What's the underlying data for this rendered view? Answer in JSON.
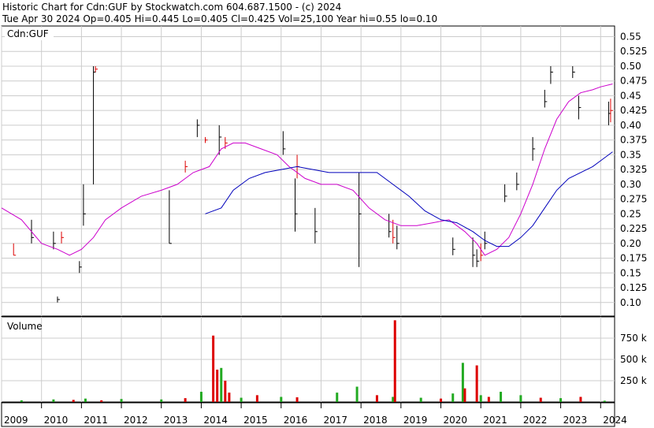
{
  "header": {
    "line1": "Historic Chart for Cdn:GUF by Stockwatch.com 604.687.1500 - (c) 2024",
    "line2": "Tue Apr 30 2024   Op=0.405   Hi=0.445   Lo=0.405   Cl=0.425   Vol=25,100   Year hi=0.55   lo=0.10"
  },
  "price_panel": {
    "label": "Cdn:GUF"
  },
  "volume_panel": {
    "label": "Volume"
  },
  "colors": {
    "price_up": "#000000",
    "price_down": "#dd0000",
    "ma_short": "#cc00cc",
    "ma_long": "#0000bb",
    "vol_up": "#22aa22",
    "vol_down": "#dd0000",
    "vol_flat": "#888888",
    "grid": "#cccccc"
  },
  "chart_data": [
    {
      "type": "line",
      "name": "price",
      "y_ticks": [
        "0.55",
        "0.525",
        "0.50",
        "0.475",
        "0.45",
        "0.425",
        "0.40",
        "0.375",
        "0.35",
        "0.325",
        "0.30",
        "0.275",
        "0.25",
        "0.225",
        "0.20",
        "0.175",
        "0.15",
        "0.125",
        "0.10"
      ],
      "y_tick_values": [
        0.55,
        0.525,
        0.5,
        0.475,
        0.45,
        0.425,
        0.4,
        0.375,
        0.35,
        0.325,
        0.3,
        0.275,
        0.25,
        0.225,
        0.2,
        0.175,
        0.15,
        0.125,
        0.1
      ],
      "ylim": [
        0.077,
        0.568
      ],
      "xlim": [
        2009.0,
        2024.35
      ],
      "x_ticks": [
        "2009",
        "2010",
        "2011",
        "2012",
        "2013",
        "2014",
        "2015",
        "2016",
        "2017",
        "2018",
        "2019",
        "2020",
        "2021",
        "2022",
        "2023",
        "2024"
      ],
      "x_tick_values": [
        2009,
        2010,
        2011,
        2012,
        2013,
        2014,
        2015,
        2016,
        2017,
        2018,
        2019,
        2020,
        2021,
        2022,
        2023,
        2024
      ],
      "bars": [
        {
          "x": 2009.3,
          "hi": 0.2,
          "lo": 0.18,
          "c": 0.18,
          "up": false
        },
        {
          "x": 2009.75,
          "hi": 0.24,
          "lo": 0.2,
          "c": 0.21,
          "up": true
        },
        {
          "x": 2010.3,
          "hi": 0.22,
          "lo": 0.19,
          "c": 0.2,
          "up": true
        },
        {
          "x": 2010.4,
          "hi": 0.11,
          "lo": 0.1,
          "c": 0.105,
          "up": true
        },
        {
          "x": 2010.5,
          "hi": 0.22,
          "lo": 0.2,
          "c": 0.21,
          "up": false
        },
        {
          "x": 2010.95,
          "hi": 0.17,
          "lo": 0.15,
          "c": 0.16,
          "up": true
        },
        {
          "x": 2011.05,
          "hi": 0.3,
          "lo": 0.23,
          "c": 0.25,
          "up": true
        },
        {
          "x": 2011.3,
          "hi": 0.5,
          "lo": 0.3,
          "c": 0.49,
          "up": true
        },
        {
          "x": 2011.35,
          "hi": 0.5,
          "lo": 0.49,
          "c": 0.495,
          "up": false
        },
        {
          "x": 2013.2,
          "hi": 0.29,
          "lo": 0.2,
          "c": 0.2,
          "up": true
        },
        {
          "x": 2013.6,
          "hi": 0.34,
          "lo": 0.32,
          "c": 0.33,
          "up": false
        },
        {
          "x": 2013.9,
          "hi": 0.41,
          "lo": 0.38,
          "c": 0.4,
          "up": true
        },
        {
          "x": 2014.1,
          "hi": 0.38,
          "lo": 0.37,
          "c": 0.375,
          "up": false
        },
        {
          "x": 2014.45,
          "hi": 0.4,
          "lo": 0.35,
          "c": 0.38,
          "up": true
        },
        {
          "x": 2014.6,
          "hi": 0.38,
          "lo": 0.36,
          "c": 0.37,
          "up": false
        },
        {
          "x": 2016.05,
          "hi": 0.39,
          "lo": 0.35,
          "c": 0.36,
          "up": true
        },
        {
          "x": 2016.35,
          "hi": 0.31,
          "lo": 0.22,
          "c": 0.25,
          "up": true
        },
        {
          "x": 2016.4,
          "hi": 0.35,
          "lo": 0.31,
          "c": 0.33,
          "up": false
        },
        {
          "x": 2016.85,
          "hi": 0.26,
          "lo": 0.2,
          "c": 0.22,
          "up": true
        },
        {
          "x": 2017.95,
          "hi": 0.32,
          "lo": 0.16,
          "c": 0.25,
          "up": true
        },
        {
          "x": 2018.7,
          "hi": 0.25,
          "lo": 0.21,
          "c": 0.22,
          "up": true
        },
        {
          "x": 2018.8,
          "hi": 0.24,
          "lo": 0.2,
          "c": 0.21,
          "up": false
        },
        {
          "x": 2018.9,
          "hi": 0.23,
          "lo": 0.19,
          "c": 0.2,
          "up": true
        },
        {
          "x": 2020.3,
          "hi": 0.21,
          "lo": 0.18,
          "c": 0.19,
          "up": true
        },
        {
          "x": 2020.8,
          "hi": 0.21,
          "lo": 0.16,
          "c": 0.18,
          "up": true
        },
        {
          "x": 2020.9,
          "hi": 0.19,
          "lo": 0.16,
          "c": 0.17,
          "up": true
        },
        {
          "x": 2021.0,
          "hi": 0.2,
          "lo": 0.17,
          "c": 0.18,
          "up": false
        },
        {
          "x": 2021.1,
          "hi": 0.22,
          "lo": 0.19,
          "c": 0.2,
          "up": true
        },
        {
          "x": 2021.6,
          "hi": 0.3,
          "lo": 0.27,
          "c": 0.28,
          "up": true
        },
        {
          "x": 2021.9,
          "hi": 0.32,
          "lo": 0.29,
          "c": 0.3,
          "up": true
        },
        {
          "x": 2022.3,
          "hi": 0.38,
          "lo": 0.34,
          "c": 0.36,
          "up": true
        },
        {
          "x": 2022.6,
          "hi": 0.46,
          "lo": 0.43,
          "c": 0.44,
          "up": true
        },
        {
          "x": 2022.75,
          "hi": 0.5,
          "lo": 0.47,
          "c": 0.49,
          "up": true
        },
        {
          "x": 2023.3,
          "hi": 0.5,
          "lo": 0.48,
          "c": 0.49,
          "up": true
        },
        {
          "x": 2023.45,
          "hi": 0.45,
          "lo": 0.41,
          "c": 0.43,
          "up": true
        },
        {
          "x": 2024.2,
          "hi": 0.44,
          "lo": 0.4,
          "c": 0.42,
          "up": true
        },
        {
          "x": 2024.25,
          "hi": 0.445,
          "lo": 0.405,
          "c": 0.425,
          "up": false
        }
      ],
      "ma_short": {
        "x": [
          2009.0,
          2009.5,
          2010.0,
          2010.4,
          2010.7,
          2011.0,
          2011.3,
          2011.6,
          2012.0,
          2012.5,
          2013.0,
          2013.4,
          2013.8,
          2014.2,
          2014.5,
          2014.8,
          2015.1,
          2015.5,
          2015.9,
          2016.2,
          2016.6,
          2017.0,
          2017.4,
          2017.8,
          2018.2,
          2018.6,
          2019.0,
          2019.4,
          2019.8,
          2020.2,
          2020.6,
          2020.9,
          2021.1,
          2021.4,
          2021.7,
          2022.0,
          2022.3,
          2022.6,
          2022.9,
          2023.2,
          2023.5,
          2023.8,
          2024.0,
          2024.3
        ],
        "y": [
          0.26,
          0.24,
          0.2,
          0.19,
          0.18,
          0.19,
          0.21,
          0.24,
          0.26,
          0.28,
          0.29,
          0.3,
          0.32,
          0.33,
          0.36,
          0.37,
          0.37,
          0.36,
          0.35,
          0.33,
          0.31,
          0.3,
          0.3,
          0.29,
          0.26,
          0.24,
          0.23,
          0.23,
          0.235,
          0.24,
          0.22,
          0.2,
          0.18,
          0.19,
          0.21,
          0.25,
          0.3,
          0.36,
          0.41,
          0.44,
          0.455,
          0.46,
          0.465,
          0.47
        ]
      },
      "ma_long": {
        "x": [
          2014.1,
          2014.5,
          2014.8,
          2015.2,
          2015.6,
          2016.0,
          2016.4,
          2016.8,
          2017.2,
          2017.6,
          2018.0,
          2018.4,
          2018.8,
          2019.2,
          2019.6,
          2020.0,
          2020.4,
          2020.8,
          2021.1,
          2021.4,
          2021.7,
          2022.0,
          2022.3,
          2022.6,
          2022.9,
          2023.2,
          2023.5,
          2023.8,
          2024.0,
          2024.3
        ],
        "y": [
          0.25,
          0.26,
          0.29,
          0.31,
          0.32,
          0.325,
          0.33,
          0.325,
          0.32,
          0.32,
          0.32,
          0.32,
          0.3,
          0.28,
          0.255,
          0.24,
          0.235,
          0.22,
          0.205,
          0.195,
          0.195,
          0.21,
          0.23,
          0.26,
          0.29,
          0.31,
          0.32,
          0.33,
          0.34,
          0.355
        ]
      }
    },
    {
      "type": "bar",
      "name": "Volume",
      "y_ticks": [
        "750 k",
        "500 k",
        "250 k"
      ],
      "y_tick_values": [
        750,
        500,
        250
      ],
      "ylim": [
        0,
        1000
      ],
      "x": [
        2009.5,
        2010.3,
        2010.8,
        2011.1,
        2011.5,
        2012.0,
        2013.0,
        2013.6,
        2014.0,
        2014.3,
        2014.4,
        2014.5,
        2014.6,
        2014.7,
        2015.0,
        2015.4,
        2016.0,
        2016.4,
        2017.4,
        2017.9,
        2018.4,
        2018.8,
        2018.85,
        2019.5,
        2020.0,
        2020.3,
        2020.55,
        2020.6,
        2020.9,
        2021.0,
        2021.2,
        2021.5,
        2022.0,
        2022.5,
        2023.0,
        2023.5,
        2024.1
      ],
      "values": [
        20,
        30,
        25,
        40,
        20,
        35,
        30,
        45,
        120,
        780,
        380,
        400,
        250,
        110,
        50,
        80,
        60,
        55,
        110,
        180,
        80,
        60,
        960,
        50,
        40,
        100,
        460,
        160,
        430,
        80,
        60,
        120,
        80,
        50,
        45,
        60,
        15
      ],
      "up": [
        true,
        true,
        false,
        true,
        false,
        true,
        true,
        false,
        true,
        false,
        false,
        true,
        false,
        false,
        true,
        false,
        true,
        false,
        true,
        true,
        false,
        true,
        false,
        true,
        false,
        true,
        true,
        false,
        false,
        true,
        false,
        true,
        true,
        false,
        true,
        false,
        true
      ]
    }
  ]
}
